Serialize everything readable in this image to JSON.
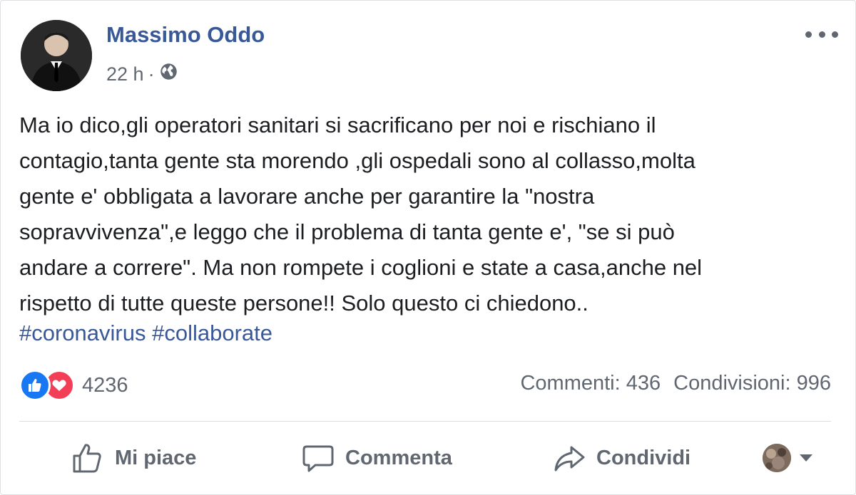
{
  "post": {
    "author": "Massimo Oddo",
    "time": "22 h",
    "separator": "·",
    "audience_icon": "globe-icon",
    "more_icon": "more-options-icon",
    "text_lines": [
      "Ma io dico,gli operatori sanitari si sacrificano per noi e rischiano il",
      "contagio,tanta gente sta morendo ,gli ospedali sono al collasso,molta",
      "gente e' obbligata a lavorare anche per garantire la \"nostra",
      "sopravvivenza\",e leggo che il problema di tanta gente e', \"se si può",
      "andare a correre\". Ma non rompete i coglioni e state a casa,anche nel",
      "rispetto di tutte queste persone!! Solo questo ci chiedono.."
    ],
    "hashtags": [
      "#coronavirus",
      "#collaborate"
    ]
  },
  "stats": {
    "reaction_icons": [
      "like-reaction-icon",
      "love-reaction-icon"
    ],
    "reactions": "4236",
    "comments": "Commenti: 436",
    "shares": "Condivisioni: 996"
  },
  "actions": {
    "like": "Mi piace",
    "comment": "Commenta",
    "share": "Condividi"
  },
  "colors": {
    "link": "#385898",
    "muted": "#606770",
    "like": "#1877f2",
    "love": "#f33e58"
  }
}
